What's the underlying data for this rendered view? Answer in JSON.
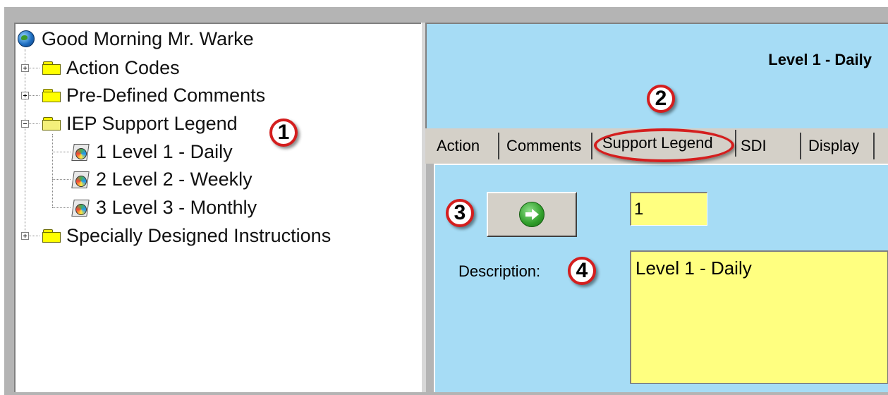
{
  "tree": {
    "root_label": "Good Morning Mr. Warke",
    "items": [
      {
        "label": "Action Codes",
        "expanded": false
      },
      {
        "label": "Pre-Defined Comments",
        "expanded": false
      },
      {
        "label": "IEP Support Legend",
        "expanded": true,
        "children": [
          {
            "label": "1 Level 1 - Daily"
          },
          {
            "label": "2 Level 2 - Weekly"
          },
          {
            "label": "3 Level 3 - Monthly"
          }
        ]
      },
      {
        "label": "Specially Designed Instructions",
        "expanded": false
      }
    ]
  },
  "header": {
    "title": "Level 1 - Daily"
  },
  "tabs": [
    {
      "label": "Action"
    },
    {
      "label": "Comments"
    },
    {
      "label": "Support Legend",
      "selected": true
    },
    {
      "label": "SDI"
    },
    {
      "label": "Display"
    }
  ],
  "form": {
    "code_value": "1",
    "description_label": "Description:",
    "description_value": "Level 1 - Daily"
  },
  "callouts": [
    "1",
    "2",
    "3",
    "4"
  ],
  "colors": {
    "panel_bg": "#a6dcf5",
    "field_bg": "#ffff80",
    "callout_red": "#d41e1e",
    "frame_gray": "#b4b4b4"
  },
  "icons": {
    "root": "globe-icon",
    "folder": "folder-icon",
    "leaf": "disc-document-icon",
    "go": "green-arrow-icon"
  }
}
